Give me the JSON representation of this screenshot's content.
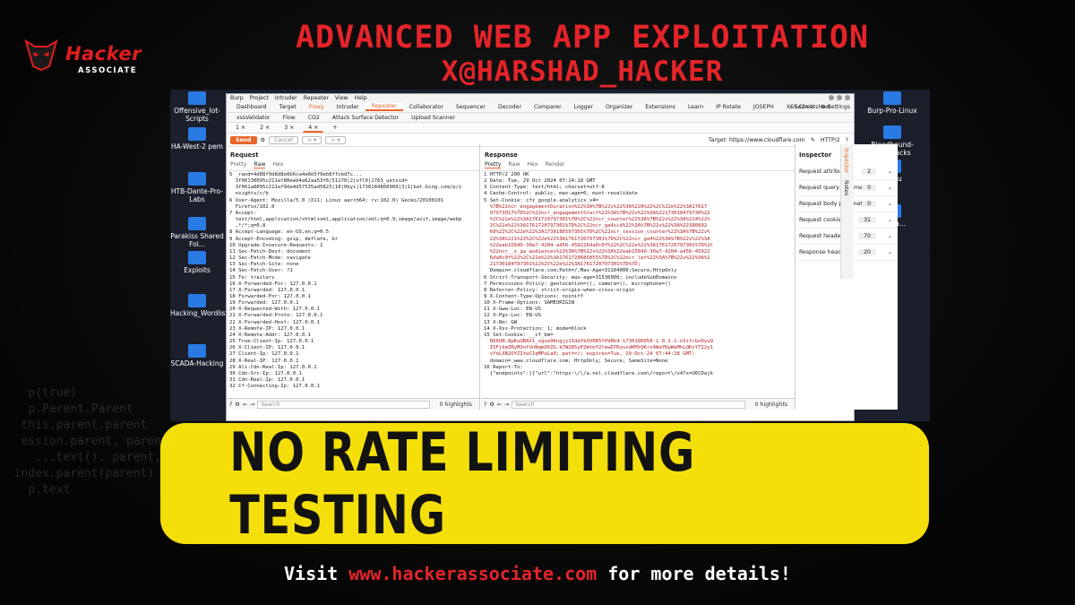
{
  "header": {
    "logo_name": "Hacker",
    "logo_sub": "ASSOCIATE",
    "title": "ADVANCED WEB APP EXPLOITATION",
    "handle": "X@HARSHAD_HACKER"
  },
  "desktop": {
    "left_icons": [
      "Offensive_Iot-Scripts",
      "HA-West-2 pem",
      "HTB-Dante-Pro-Labs",
      "Parakiss Shared Fol...",
      "Exploits",
      "Hacking_Wordlists",
      "SCADA-Hacking"
    ],
    "right_icons": [
      "Burp-Pro-Linux",
      "Bloodhound-AD-Attacks",
      "qemu",
      "IoT-Sa..."
    ]
  },
  "burp": {
    "menu": [
      "Burp",
      "Project",
      "Intruder",
      "Repeater",
      "View",
      "Help"
    ],
    "tabs": [
      "Dashboard",
      "Target",
      "Proxy",
      "Intruder",
      "Repeater",
      "Collaborator",
      "Sequencer",
      "Decoder",
      "Comparer",
      "Logger",
      "Organizer",
      "Extensions",
      "Learn",
      "IP Rotate",
      "JOSEPH",
      "XSS Cheatsheet"
    ],
    "active_tab": "Repeater",
    "tabs_right": [
      "Search",
      "Settings"
    ],
    "tabs2": [
      "xssValidator",
      "Flow",
      "CO2",
      "Attack Surface Detector",
      "Upload Scanner"
    ],
    "repeater_tabs": [
      "1 ×",
      "2 ×",
      "3 ×",
      "4 ×",
      "+"
    ],
    "send_label": "Send",
    "cancel_label": "Cancel",
    "target_label": "Target: https://www.cloudflare.com",
    "http_version": "HTTP/2",
    "request": {
      "title": "Request",
      "subtabs": [
        "Pretty",
        "Raw",
        "Hex"
      ],
      "lines": [
        "5 _rand=4d88f9d8d8e8b6ca4e0e5f9eb8ffcbd7c...",
        "  3f06130095c211ef80eeb4a62aa53f6|51170|2|ofl0|1763_uetsid=",
        "  3f061a8095c211ef9da4d57535ad5823|10|0byi|1730184860960|3|1|bat.bing.com/p/i",
        "  nsights/c/b",
        "6 User-Agent: Mozilla/5.0 (X11; Linux aarch64; rv:102.0) Gecko/20100101",
        "  Firefox/102.0",
        "7 Accept:",
        "  text/html,application/xhtml+xml,application/xml;q=0.9,image/avif,image/webp",
        "  ,*/*;q=0.8",
        "8 Accept-Language: en-US,en;q=0.5",
        "9 Accept-Encoding: gzip, deflate, br",
        "10 Upgrade-Insecure-Requests: 1",
        "11 Sec-Fetch-Dest: document",
        "12 Sec-Fetch-Mode: navigate",
        "13 Sec-Fetch-Site: none",
        "14 Sec-Fetch-User: ?1",
        "15 Te: trailers",
        "16 X-Forwarded-For: 127.0.0.1",
        "17 X-Forwarded: 127.0.0.1",
        "18 Forwarded-For: 127.0.0.1",
        "19 Forwarded: 127.0.0.1",
        "20 X-Requested-With: 127.0.0.1",
        "21 X-Forwarded-Proto: 127.0.0.1",
        "22 X-Forwarded-Host: 127.0.0.1",
        "23 X-Remote-IP: 127.0.0.1",
        "24 X-Remote-Addr: 127.0.0.1",
        "25 True-Client-Ip: 127.0.0.1",
        "26 X-Client-IP: 127.0.0.1",
        "27 Client-Ip: 127.0.0.1",
        "28 X-Real-IP: 127.0.0.1",
        "29 Ali-Cdn-Real-Ip: 127.0.0.1",
        "30 Cdn-Src-Ip: 127.0.0.1",
        "31 Cdn-Real-Ip: 127.0.0.1",
        "32 Cf-Connecting-Ip: 127.0.0.1"
      ],
      "search_placeholder": "Search",
      "highlights": "0 highlights"
    },
    "response": {
      "title": "Response",
      "subtabs": [
        "Pretty",
        "Raw",
        "Hex",
        "Render"
      ],
      "lines": [
        "1 HTTP/2 200 OK",
        "2 Date: Tue, 29 Oct 2024 07:14:18 GMT",
        "3 Content-Type: text/html; charset=utf-8",
        "4 Cache-Control: public, max-age=0, must-revalidate",
        "5 Set-Cookie: cfz_google-analytics_v4=",
        "  %7B%22ncr_engagementDuration%22%3A%7B%22v%22%3A%220%22%2C%22e%22%3A17617",
        "  07973017%7D%2C%22ncr_engagementStart%22%3A%7B%22v%22%3A%22173018479730%22",
        "  %2C%22e%22%3A1761720797301%7D%2C%22ncr_counter%22%3A%7B%22v%22%3A%224%22%",
        "  2C%22e%22%3A1761720797301%7D%2C%22ncr_ga4sid%22%3A%7B%22v%22%3A%22380892",
        "  60%22%2C%22e%22%3A1730186597301%7D%2C%22ncr_session_counter%22%3A%7B%22v%",
        "  22%3A%221%22%2C%22e%22%3A1761720797301%7D%2C%22ncr_ga4%22%3A%7B%22v%22%3A",
        "  %22eab15840-30a7-4204-a456-459226da0c0f%22%2C%22e%22%3A1761720797301%7D%2C",
        "  %22ncr__z_ga_audiences%22%3A%7B%22v%22%3A%22eab15840-30a7-4204-a456-45922",
        "  6da0c0f%22%2C%22e%22%3A1761720685055%7D%2C%22ncr_let%22%3A%7B%22v%22%3A%2",
        "  21730184797301%22%2C%22e%22%3A1761720797301%7D%7D;",
        "  Domain=.cloudflare.com;Path=/;Max-Age=31104000;Secure;HttpOnly",
        "6 Strict-Transport-Security: max-age=31536000; includeSubDomains",
        "7 Permissions-Policy: geolocation=(), camera=(), microphone=()",
        "8 Referrer-Policy: strict-origin-when-cross-origin",
        "9 X-Content-Type-Options: nosniff",
        "10 X-Frame-Options: SAMEORIGIN",
        "11 X-Gww-Loc: EN-US",
        "12 X-Pgs-Loc: EN-US",
        "13 X-Rm: GW",
        "14 X-Xss-Protection: 1; mode=block",
        "15 Set-Cookie: __cf_bm=",
        "  R66UN.8pKuUBAX1_sgue9Kngjy1IdaYkOV0R5fOVRk4-1730186058-1.0.1.1-nSifrGo6yuQ",
        "  I5FjkmZRyM3ofUnNqmX6ZG.k7W285yP2Wtmf2tewD7RzusdKMtQKrs4WaYKwWeMhLQKsYT22y1",
        "  vYnLXB2OYZItwC1qMPuLa0; path=/; expires=Tue, 29-Oct-24 07:44:18 GMT;",
        "  domain=.www.cloudflare.com; HttpOnly; Secure; SameSite=None",
        "16 Report-To:",
        "  {\"endpoints\":[{\"url\":\"https:\\/\\/a.nel.cloudflare.com\\/report\\/v4?s=U6CDajk"
      ],
      "search_placeholder": "Search",
      "highlights": "0 highlights"
    },
    "inspector": {
      "title": "Inspector",
      "rows": [
        {
          "label": "Request attributes",
          "count": "2"
        },
        {
          "label": "Request query parameters",
          "count": "0"
        },
        {
          "label": "Request body parameters",
          "count": "0"
        },
        {
          "label": "Request cookies",
          "count": "31"
        },
        {
          "label": "Request headers",
          "count": "70"
        },
        {
          "label": "Response headers",
          "count": "20"
        }
      ],
      "side_tabs": [
        "Inspector",
        "Notes"
      ]
    }
  },
  "banner": {
    "text": "NO RATE LIMITING TESTING"
  },
  "footer": {
    "prefix": "Visit ",
    "link": "www.hackerassociate.com",
    "suffix": " for more details!"
  },
  "colors": {
    "accent_red": "#e5242a",
    "banner_yellow": "#f5df0a",
    "burp_orange": "#e8652a"
  }
}
